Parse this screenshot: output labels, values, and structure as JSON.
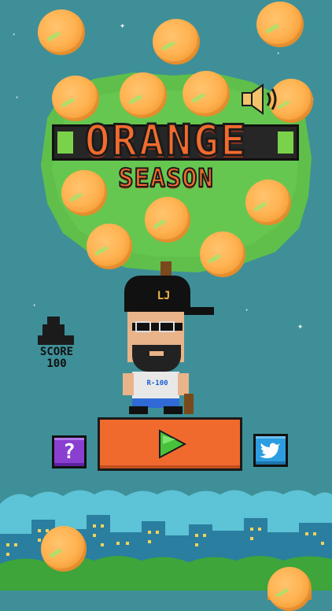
{
  "title": {
    "line1": "ORANGE",
    "line2": "SEASON"
  },
  "player": {
    "cap_text": "LJ",
    "shirt_text": "R-100"
  },
  "score": {
    "label": "SCORE",
    "value": "100"
  },
  "buttons": {
    "help_label": "?",
    "play_icon": "play-icon",
    "twitter_icon": "twitter-bird-icon",
    "sound_icon": "speaker-icon"
  },
  "colors": {
    "sky": "#3f8f98",
    "orange": "#ffb352",
    "title_fill": "#f26b2e",
    "play_bg": "#f06a2e",
    "help_bg": "#8a3fd1",
    "twitter_bg": "#2c9de0",
    "tree": "#5fbf4a",
    "bar": "#7ad24a"
  }
}
